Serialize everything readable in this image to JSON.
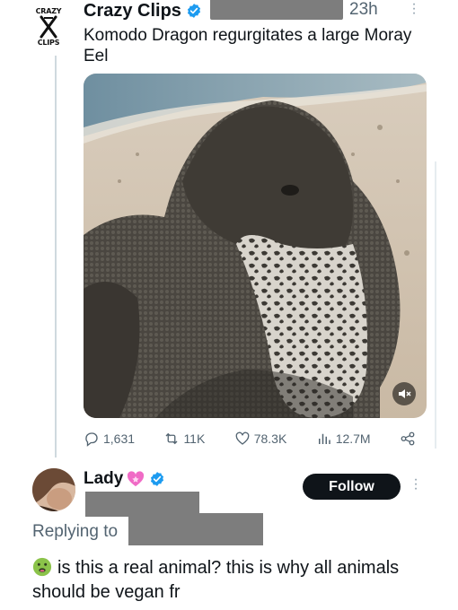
{
  "post": {
    "logo_top": "CRAZY",
    "logo_bottom": "CLIPS",
    "display_name": "Crazy Clips",
    "time": "23h",
    "text": "Komodo Dragon regurgitates a large Moray Eel",
    "stats": {
      "replies": "1,631",
      "reposts": "11K",
      "likes": "78.3K",
      "views": "12.7M"
    }
  },
  "reply": {
    "display_name": "Lady",
    "follow_label": "Follow",
    "replying_to_label": "Replying to",
    "text": "is this a real animal? this is why all animals should be vegan fr"
  },
  "icons": {
    "verified": "verified-badge-icon",
    "more": "more-dots-icon",
    "mute": "speaker-muted-icon",
    "reply": "reply-bubble-icon",
    "repost": "repost-icon",
    "like": "heart-icon",
    "views": "views-bars-icon",
    "share": "share-icon",
    "heart_emoji": "pink-heart-emoji-icon",
    "sick_emoji": "nauseated-face-emoji-icon"
  },
  "colors": {
    "verified_blue": "#1d9bf0",
    "follow_bg": "#0f1419",
    "secondary_text": "#536471",
    "redaction": "#7d7d7d"
  }
}
